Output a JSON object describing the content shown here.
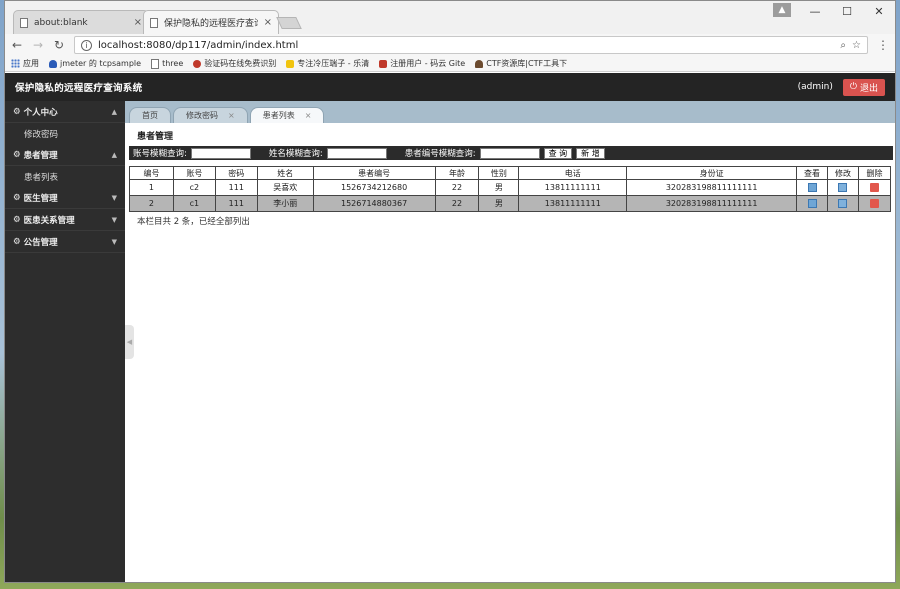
{
  "browser": {
    "tabs": [
      {
        "title": "about:blank",
        "close": "×"
      },
      {
        "title": "保护隐私的远程医疗查询",
        "close": "×"
      }
    ],
    "url": "localhost:8080/dp117/admin/index.html",
    "bookmarks": [
      {
        "label": "应用",
        "color": "#4a78c9"
      },
      {
        "label": "jmeter 的 tcpsample",
        "color": "#2a5bb8"
      },
      {
        "label": "three",
        "color": "#888888"
      },
      {
        "label": "验证码在线免费识别",
        "color": "#c0392b"
      },
      {
        "label": "专注冷压端子 - 乐清",
        "color": "#f1c40f"
      },
      {
        "label": "注册用户 - 码云 Gite",
        "color": "#c0392b"
      },
      {
        "label": "CTF资源库|CTF工具下",
        "color": "#6b4a2e"
      }
    ]
  },
  "app": {
    "title": "保护隐私的远程医疗查询系统",
    "user": "(admin)",
    "logout_label": "退出",
    "sidebar": [
      {
        "label": "个人中心",
        "expanded": true,
        "sub": [
          "修改密码"
        ]
      },
      {
        "label": "患者管理",
        "expanded": true,
        "sub": [
          "患者列表"
        ]
      },
      {
        "label": "医生管理",
        "expanded": false,
        "sub": []
      },
      {
        "label": "医患关系管理",
        "expanded": false,
        "sub": []
      },
      {
        "label": "公告管理",
        "expanded": false,
        "sub": []
      }
    ],
    "tabs": [
      {
        "label": "首页",
        "close": ""
      },
      {
        "label": "修改密码",
        "close": "×"
      },
      {
        "label": "患者列表",
        "close": "×"
      }
    ],
    "section_title": "患者管理",
    "search": {
      "account_label": "账号模糊查询:",
      "name_label": "姓名模糊查询:",
      "patient_no_label": "患者编号模糊查询:",
      "query_btn": "查 询",
      "new_btn": "新 增"
    },
    "table": {
      "headers": [
        "编号",
        "账号",
        "密码",
        "姓名",
        "患者编号",
        "年龄",
        "性别",
        "电话",
        "身份证",
        "查看",
        "修改",
        "删除"
      ],
      "rows": [
        [
          "1",
          "c2",
          "111",
          "吴喜欢",
          "1526734212680",
          "22",
          "男",
          "13811111111",
          "320283198811111111"
        ],
        [
          "2",
          "c1",
          "111",
          "李小丽",
          "1526714880367",
          "22",
          "男",
          "13811111111",
          "320283198811111111"
        ]
      ]
    },
    "footer_note": "本栏目共 2 条，已经全部列出"
  }
}
